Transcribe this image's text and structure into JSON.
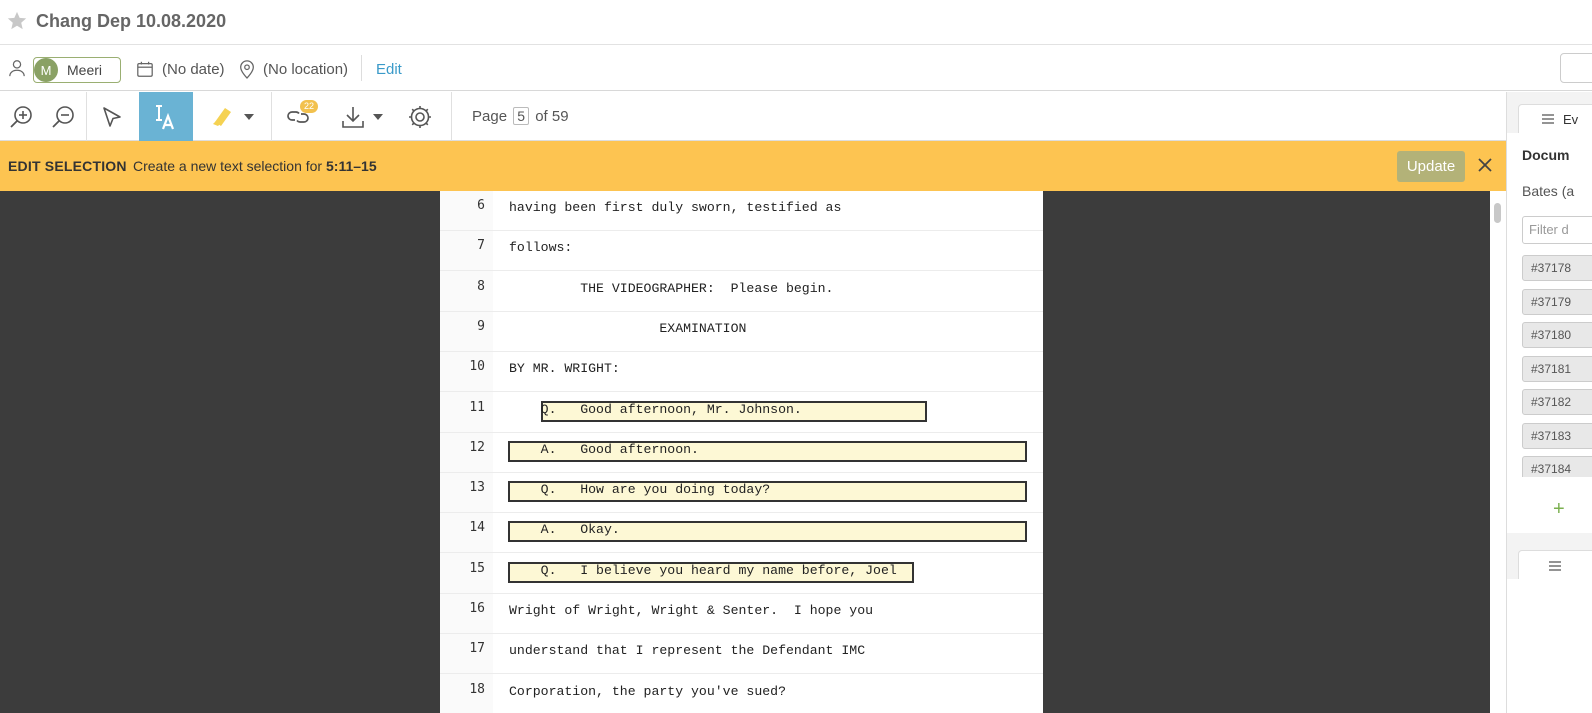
{
  "document": {
    "title": "Chang Dep 10.08.2020"
  },
  "meta": {
    "user_initial": "M",
    "user_name": "Meeri",
    "date": "(No date)",
    "location": "(No location)",
    "edit_label": "Edit"
  },
  "toolbar": {
    "links_count": "22",
    "page_prefix": "Page",
    "current_page": "5",
    "page_suffix": "of 59",
    "icons": [
      "zoom-in-icon",
      "zoom-out-icon",
      "pointer-icon",
      "text-select-icon",
      "highlighter-icon",
      "link-icon",
      "download-icon",
      "gear-icon"
    ],
    "accent_color": "#6ab3d4"
  },
  "banner": {
    "label": "EDIT SELECTION",
    "text": "Create a new text selection for ",
    "range": "5:11–15",
    "update_label": "Update",
    "color": "#fdc451"
  },
  "transcript": {
    "lines": [
      {
        "num": "6",
        "text": "having been first duly sworn, testified as"
      },
      {
        "num": "7",
        "text": "follows:"
      },
      {
        "num": "8",
        "text": "         THE VIDEOGRAPHER:  Please begin."
      },
      {
        "num": "9",
        "text": "                   EXAMINATION"
      },
      {
        "num": "10",
        "text": "BY MR. WRIGHT:"
      },
      {
        "num": "11",
        "text": "    Q.   Good afternoon, Mr. Johnson."
      },
      {
        "num": "12",
        "text": "    A.   Good afternoon."
      },
      {
        "num": "13",
        "text": "    Q.   How are you doing today?"
      },
      {
        "num": "14",
        "text": "    A.   Okay."
      },
      {
        "num": "15",
        "text": "    Q.   I believe you heard my name before, Joel"
      },
      {
        "num": "16",
        "text": "Wright of Wright, Wright & Senter.  I hope you"
      },
      {
        "num": "17",
        "text": "understand that I represent the Defendant IMC"
      },
      {
        "num": "18",
        "text": "Corporation, the party you've sued?"
      }
    ],
    "selection_color": "#fdf8d5"
  },
  "right_panel": {
    "tab1_label": "Ev",
    "heading": "Docum",
    "subheading": "Bates (a",
    "filter_placeholder": "Filter d",
    "items": [
      "#37178",
      "#37179",
      "#37180",
      "#37181",
      "#37182",
      "#37183",
      "#37184"
    ],
    "add_label": "+"
  }
}
